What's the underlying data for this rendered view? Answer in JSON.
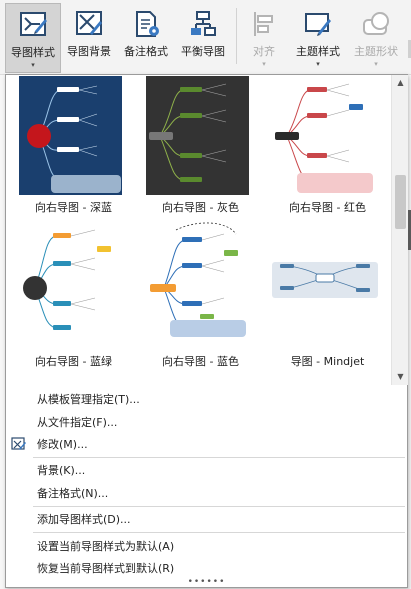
{
  "toolbar": {
    "buttons": [
      {
        "label": "导图样式",
        "icon": "map-style-icon",
        "dropdown": true,
        "active": true
      },
      {
        "label": "导图背景",
        "icon": "map-background-icon"
      },
      {
        "label": "备注格式",
        "icon": "note-format-icon"
      },
      {
        "label": "平衡导图",
        "icon": "balance-map-icon"
      },
      {
        "label": "对齐",
        "icon": "align-icon",
        "dropdown": true,
        "disabled": true
      },
      {
        "label": "主题样式",
        "icon": "topic-style-icon",
        "dropdown": true
      },
      {
        "label": "主题形状",
        "icon": "topic-shape-icon",
        "dropdown": true,
        "disabled": true
      }
    ],
    "caret": "▾"
  },
  "gallery": {
    "items": [
      {
        "label": "向右导图 - 深蓝",
        "theme": "dark-blue",
        "bg": "#1a3f6e",
        "center": "#c4161c"
      },
      {
        "label": "向右导图 - 灰色",
        "theme": "gray",
        "bg": "#333333",
        "center": "#666666"
      },
      {
        "label": "向右导图 - 红色",
        "theme": "red",
        "bg": "#ffffff",
        "center": "#2b2b2b"
      },
      {
        "label": "向右导图 - 蓝绿",
        "theme": "blue-green",
        "bg": "#ffffff",
        "center": "#333333"
      },
      {
        "label": "向右导图 - 蓝色",
        "theme": "blue",
        "bg": "#ffffff",
        "center": "#f39c33"
      },
      {
        "label": "导图 - Mindjet",
        "theme": "mindjet",
        "bg": "#ffffff",
        "center": "#4a7aa6"
      }
    ],
    "scroll_up": "▲",
    "scroll_down": "▼"
  },
  "menu": {
    "items": [
      {
        "label": "从模板管理指定(T)..."
      },
      {
        "label": "从文件指定(F)..."
      },
      {
        "label": "修改(M)...",
        "icon": "modify-style-icon"
      },
      {
        "label": "背景(K)..."
      },
      {
        "label": "备注格式(N)..."
      },
      {
        "label": "添加导图样式(D)..."
      },
      {
        "label": "设置当前导图样式为默认(A)"
      },
      {
        "label": "恢复当前导图样式到默认(R)"
      }
    ],
    "grip": "••••••"
  }
}
